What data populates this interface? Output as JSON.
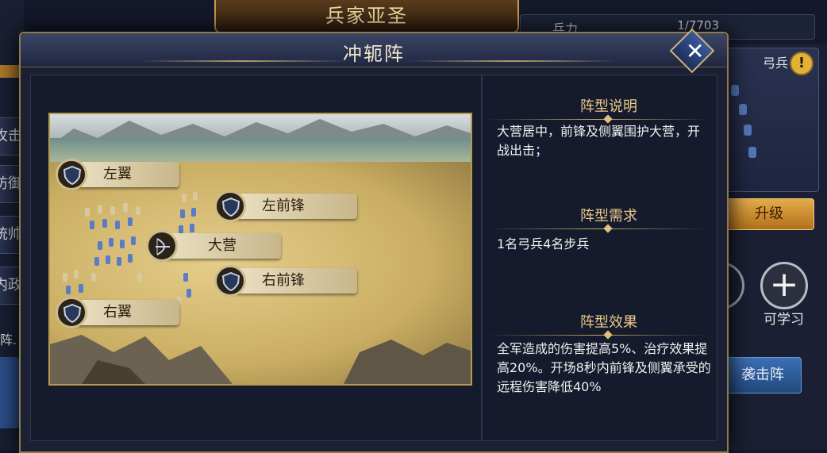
{
  "background": {
    "banner_title": "兵家亚圣",
    "troops_label": "兵力",
    "troops_value": "1/7703",
    "left_tabs": [
      "攻击",
      "防御",
      "统帅",
      "内政"
    ],
    "left_text": "阵.",
    "archer_name": "弓兵",
    "warning_icon": "!",
    "upgrade_label": "升级",
    "learnable_label": "可学习",
    "attack_button_label": "袭击阵"
  },
  "dialog": {
    "title": "冲轭阵",
    "close_label": "✕"
  },
  "formation_map": {
    "labels": {
      "left_wing": "左翼",
      "left_vanguard": "左前锋",
      "camp": "大营",
      "right_vanguard": "右前锋",
      "right_wing": "右翼"
    }
  },
  "info_panel": {
    "description_heading": "阵型说明",
    "description_text": "大营居中，前锋及侧翼围护大营，开战出击；",
    "requirement_heading": "阵型需求",
    "requirement_text": "1名弓兵4名步兵",
    "effect_heading": "阵型效果",
    "effect_text": "全军造成的伤害提高5%、治疗效果提高20%。开场8秒内前锋及侧翼承受的远程伤害降低40%"
  },
  "colors": {
    "accent_gold": "#e8c98a",
    "dialog_bg": "#1b2034",
    "label_bg": "#ede2c6",
    "upgrade_button": "#e4ac4a",
    "attack_button": "#3b6fb4"
  }
}
